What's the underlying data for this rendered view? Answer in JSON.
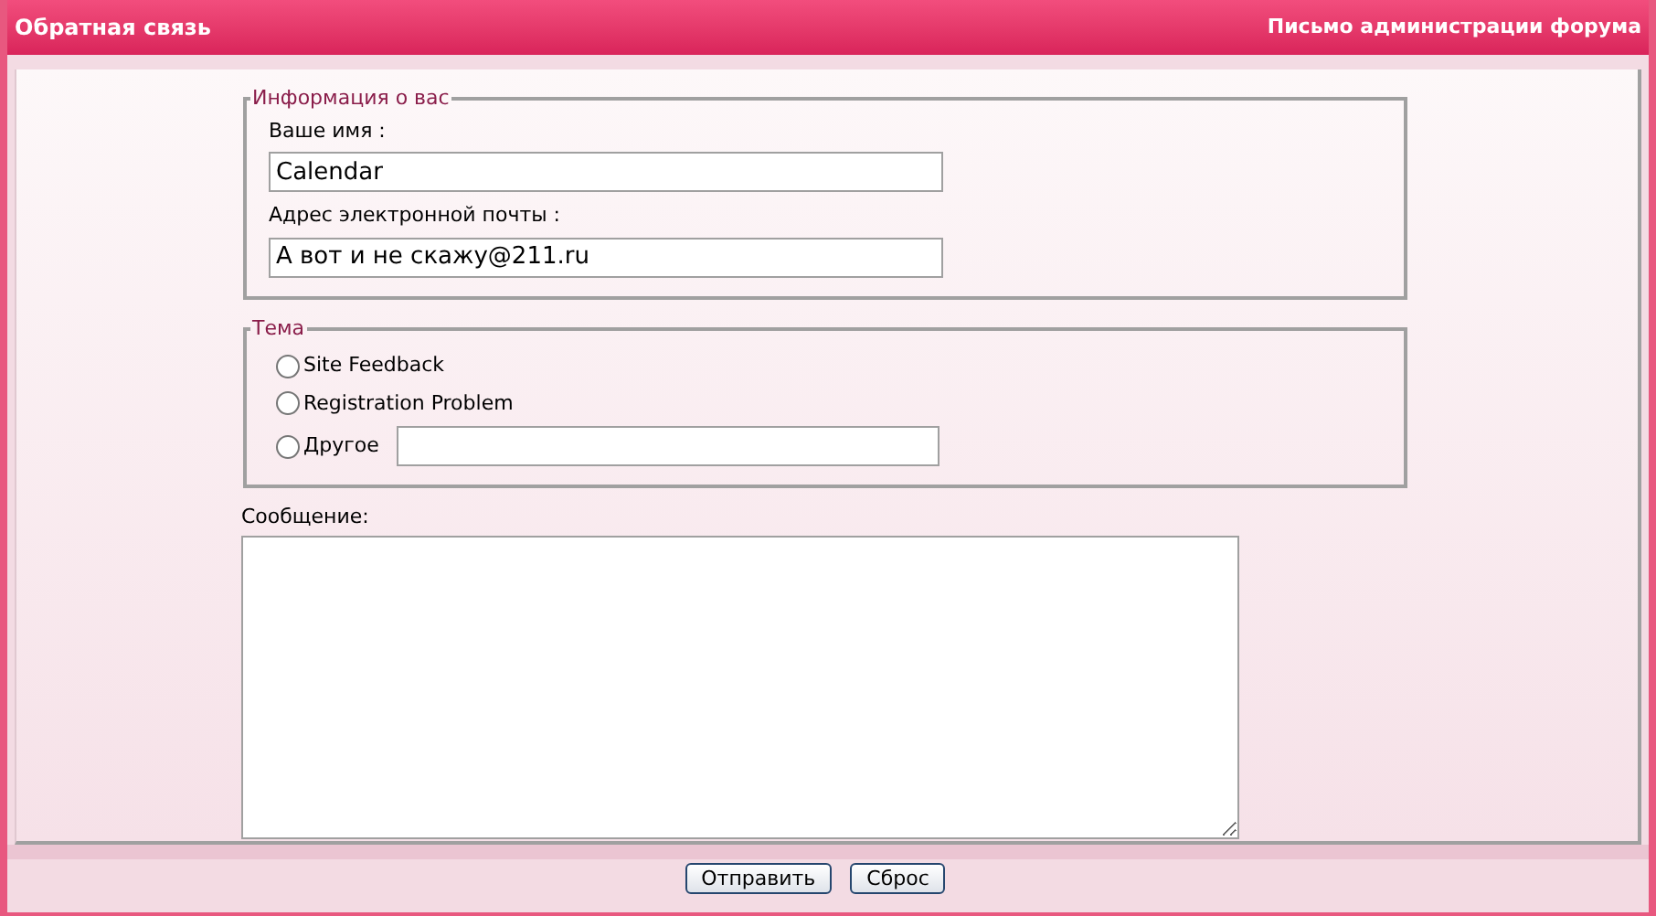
{
  "header": {
    "title": "Обратная связь",
    "subtitle": "Письмо администрации форума"
  },
  "about": {
    "legend": "Информация о вас",
    "fields": [
      {
        "label": "Ваше имя :",
        "value": "Calendar"
      },
      {
        "label": "Адрес электронной почты :",
        "value": "А вот и не скажу@211.ru"
      }
    ]
  },
  "topic": {
    "legend": "Тема",
    "options": [
      {
        "label": "Site Feedback",
        "selected": false,
        "kind": "plain"
      },
      {
        "label": "Registration Problem",
        "selected": false,
        "kind": "plain"
      },
      {
        "label": "Другое",
        "selected": false,
        "kind": "other"
      }
    ]
  },
  "message": {
    "label": "Сообщение:"
  },
  "buttons": [
    "Отправить",
    "Сброс"
  ]
}
